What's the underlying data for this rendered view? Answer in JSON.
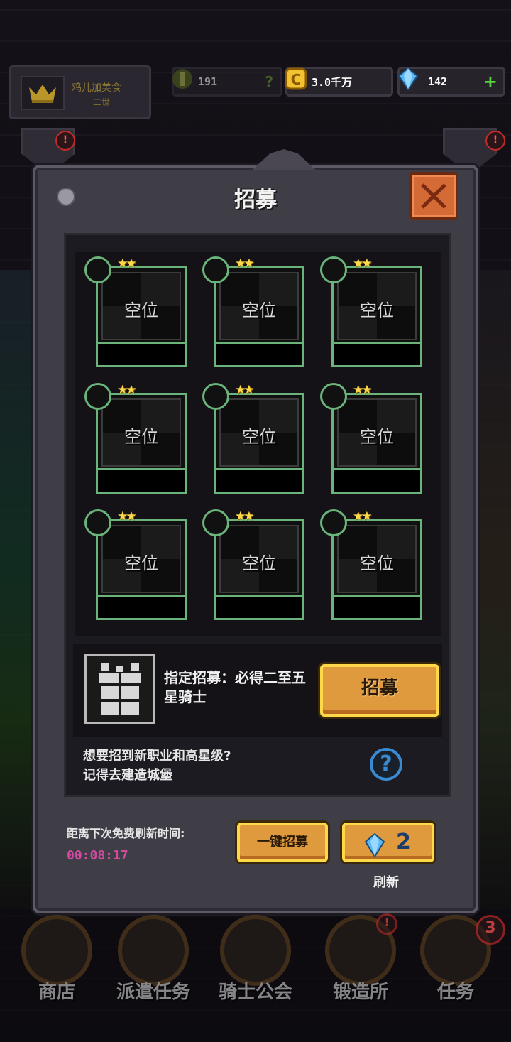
{
  "top_bar": {
    "player_name": "鸡儿加美食",
    "player_sub": "二世",
    "power": "191",
    "gold": "3.0千万",
    "gems": "142",
    "alert_mark": "!"
  },
  "modal": {
    "title": "招募",
    "slots": [
      {
        "label": "空位",
        "stars": "★★"
      },
      {
        "label": "空位",
        "stars": "★★"
      },
      {
        "label": "空位",
        "stars": "★★"
      },
      {
        "label": "空位",
        "stars": "★★"
      },
      {
        "label": "空位",
        "stars": "★★"
      },
      {
        "label": "空位",
        "stars": "★★"
      },
      {
        "label": "空位",
        "stars": "★★"
      },
      {
        "label": "空位",
        "stars": "★★"
      },
      {
        "label": "空位",
        "stars": "★★"
      }
    ],
    "special": {
      "text": "指定招募：必得二至五星骑士",
      "button": "招募"
    },
    "hint_line1": "想要招到新职业和高星级?",
    "hint_line2": "记得去建造城堡",
    "help_symbol": "?",
    "refresh_label": "距离下次免费刷新时间:",
    "timer": "00:08:17",
    "one_key_button": "一键招募",
    "refresh_cost": "2",
    "refresh_word": "刷新"
  },
  "nav": {
    "items": [
      {
        "label": "商店"
      },
      {
        "label": "派遣任务"
      },
      {
        "label": "骑士公会"
      },
      {
        "label": "锻造所"
      },
      {
        "label": "任务"
      }
    ],
    "forge_alert": "!",
    "task_count": "3"
  },
  "colors": {
    "slot_border": "#6ab37a",
    "button_gold": "#e09a3e",
    "timer": "#d24aa0",
    "help_blue": "#3a8ad2",
    "close_orange": "#d46a36"
  }
}
